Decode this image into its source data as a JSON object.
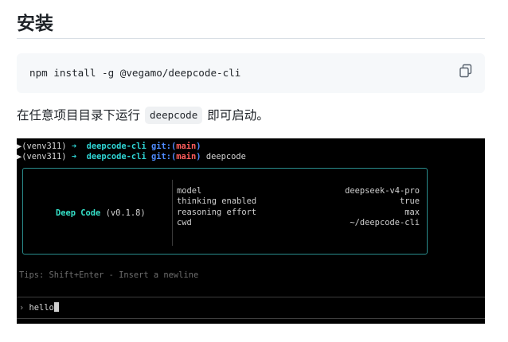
{
  "heading": "安装",
  "install": {
    "command": "npm install -g @vegamo/deepcode-cli",
    "copy_icon": "copy-icon"
  },
  "para": {
    "before": "在任意项目目录下运行",
    "code": "deepcode",
    "after": "即可启动。"
  },
  "terminal": {
    "lines": [
      {
        "marker": "▶",
        "env": "(venv311)",
        "arrow": "➜",
        "dir": "deepcode-cli",
        "git_label": "git:(",
        "branch": "main",
        "git_close": ")",
        "cmd": ""
      },
      {
        "marker": "▶",
        "env": "(venv311)",
        "arrow": "➜",
        "dir": "deepcode-cli",
        "git_label": "git:(",
        "branch": "main",
        "git_close": ")",
        "cmd": "deepcode"
      }
    ],
    "brand_name": "Deep Code",
    "brand_version": "(v0.1.8)",
    "info": [
      {
        "key": "model",
        "value": "deepseek-v4-pro"
      },
      {
        "key": "thinking enabled",
        "value": "true"
      },
      {
        "key": "reasoning effort",
        "value": "max"
      },
      {
        "key": "cwd",
        "value": "~/deepcode-cli"
      }
    ],
    "tips": "Tips: Shift+Enter - Insert a newline",
    "prompt_symbol": "›",
    "input_value": "hello"
  },
  "colors": {
    "terminal_bg": "#000000",
    "cyan": "#2fd4d4",
    "blue": "#4f8cff",
    "red": "#ff5d5d",
    "box_border": "#2a8c8c"
  }
}
